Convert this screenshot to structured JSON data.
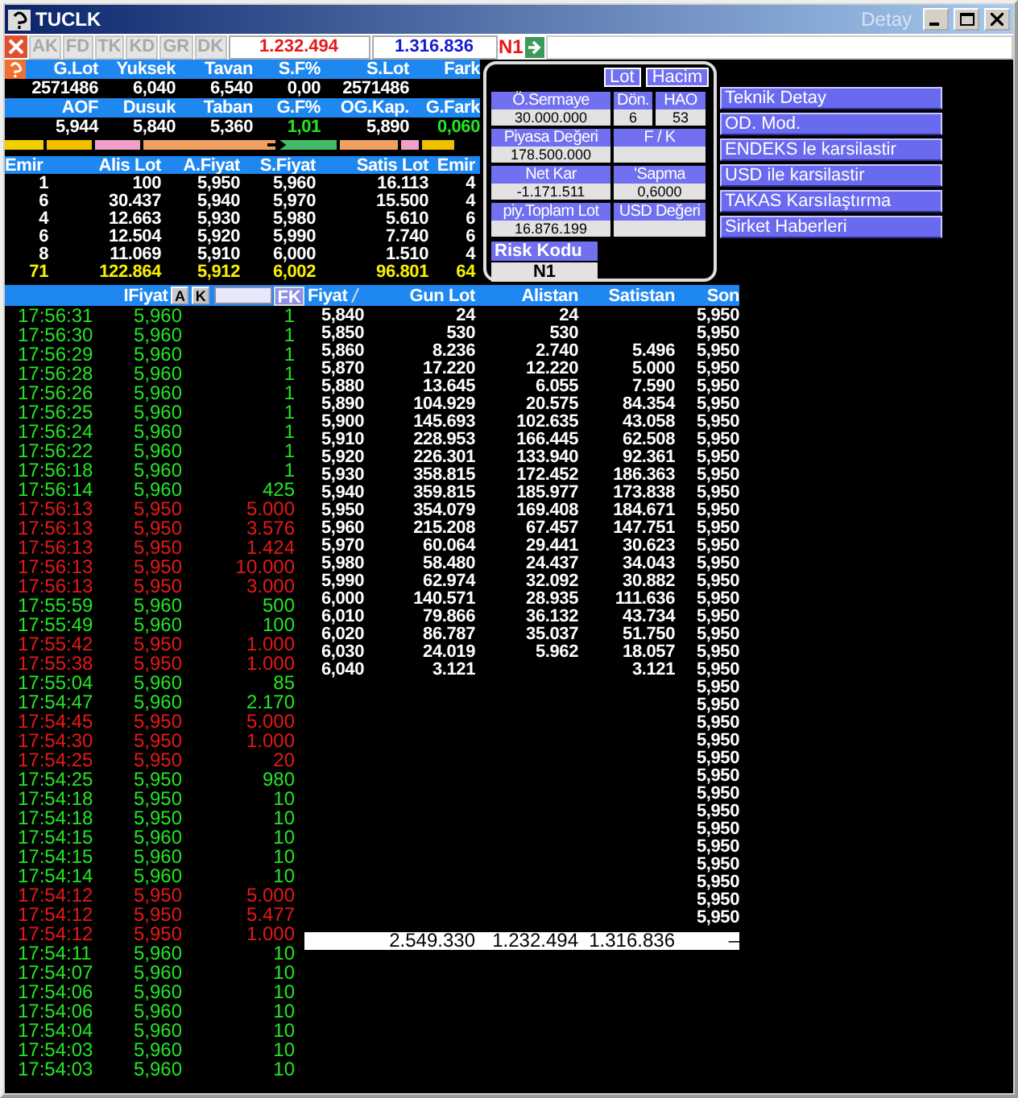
{
  "window": {
    "title": "TUCLK",
    "subtitle": "Detay"
  },
  "toolbar": {
    "buttons": [
      {
        "label": "AK",
        "disabled": true
      },
      {
        "label": "FD",
        "disabled": true
      },
      {
        "label": "TK",
        "disabled": true
      },
      {
        "label": "KD",
        "disabled": true
      },
      {
        "label": "GR",
        "disabled": true
      },
      {
        "label": "DK",
        "disabled": true
      }
    ],
    "bid_total": "1.232.494",
    "ask_total": "1.316.836",
    "risk": "N1"
  },
  "summary": {
    "rows": [
      {
        "headers": [
          "G.Lot",
          "Yuksek",
          "Tavan",
          "S.F%",
          "S.Lot",
          "Fark"
        ],
        "values": [
          {
            "text": "2571486",
            "positive": false
          },
          {
            "text": "6,040",
            "positive": false
          },
          {
            "text": "6,540",
            "positive": false
          },
          {
            "text": "0,00",
            "positive": false
          },
          {
            "text": "2571486",
            "positive": false
          }
        ]
      },
      {
        "headers": [
          "AOF",
          "Dusuk",
          "Taban",
          "G.F%",
          "OG.Kap.",
          "G.Fark"
        ],
        "values": [
          {
            "text": "5,944",
            "positive": false
          },
          {
            "text": "5,840",
            "positive": false
          },
          {
            "text": "5,360",
            "positive": false
          },
          {
            "text": "1,01",
            "positive": true
          },
          {
            "text": "5,890",
            "positive": false
          },
          {
            "text": "0,060",
            "positive": true
          }
        ]
      }
    ]
  },
  "depth": {
    "columns": [
      "Emir",
      "Alis Lot",
      "A.Fiyat",
      "S.Fiyat",
      "Satis Lot",
      "Emir"
    ],
    "rows": [
      [
        "1",
        "100",
        "5,950",
        "5,960",
        "16.113",
        "4"
      ],
      [
        "6",
        "30.437",
        "5,940",
        "5,970",
        "15.500",
        "4"
      ],
      [
        "4",
        "12.663",
        "5,930",
        "5,980",
        "5.610",
        "6"
      ],
      [
        "6",
        "12.504",
        "5,920",
        "5,990",
        "7.740",
        "6"
      ],
      [
        "8",
        "11.069",
        "5,910",
        "6,000",
        "1.510",
        "4"
      ]
    ],
    "total": [
      "71",
      "122.864",
      "5,912",
      "6,002",
      "96.801",
      "64"
    ]
  },
  "fundamentals": {
    "mode_buttons": [
      "Lot",
      "Hacim"
    ],
    "rows": [
      [
        {
          "label": "Ö.Sermaye",
          "value": "30.000.000"
        },
        {
          "label": "Dön.",
          "value": "6"
        },
        {
          "label": "HAO",
          "value": "53"
        }
      ],
      [
        {
          "label": "Piyasa Değeri",
          "value": "178.500.000"
        },
        {
          "label": "F / K"
        }
      ],
      [
        {
          "label": "Net Kar",
          "value": "-1.171.511"
        },
        {
          "label": "'Sapma",
          "value": "0,6000"
        }
      ],
      [
        {
          "label": "piy.Toplam Lot",
          "value": "16.876.199"
        },
        {
          "label": "USD Değeri"
        }
      ]
    ],
    "risk": {
      "label": "Risk Kodu",
      "value": "N1"
    }
  },
  "actions": [
    "Teknik Detay",
    "OD. Mod.",
    "ENDEKS le karsilastir",
    "USD ile karsilastir",
    "TAKAS Karsılaştırma",
    "Sirket Haberleri"
  ],
  "trades": {
    "price_label": "IFiyat",
    "buttons": [
      "A",
      "K"
    ],
    "filter_button": "FK",
    "rows": [
      {
        "time": "17:56:31",
        "price": "5,960",
        "lot": "1",
        "buy": true
      },
      {
        "time": "17:56:30",
        "price": "5,960",
        "lot": "1",
        "buy": true
      },
      {
        "time": "17:56:29",
        "price": "5,960",
        "lot": "1",
        "buy": true
      },
      {
        "time": "17:56:28",
        "price": "5,960",
        "lot": "1",
        "buy": true
      },
      {
        "time": "17:56:26",
        "price": "5,960",
        "lot": "1",
        "buy": true
      },
      {
        "time": "17:56:25",
        "price": "5,960",
        "lot": "1",
        "buy": true
      },
      {
        "time": "17:56:24",
        "price": "5,960",
        "lot": "1",
        "buy": true
      },
      {
        "time": "17:56:22",
        "price": "5,960",
        "lot": "1",
        "buy": true
      },
      {
        "time": "17:56:18",
        "price": "5,960",
        "lot": "1",
        "buy": true
      },
      {
        "time": "17:56:14",
        "price": "5,960",
        "lot": "425",
        "buy": true
      },
      {
        "time": "17:56:13",
        "price": "5,950",
        "lot": "5.000",
        "buy": false
      },
      {
        "time": "17:56:13",
        "price": "5,950",
        "lot": "3.576",
        "buy": false
      },
      {
        "time": "17:56:13",
        "price": "5,950",
        "lot": "1.424",
        "buy": false
      },
      {
        "time": "17:56:13",
        "price": "5,950",
        "lot": "10.000",
        "buy": false
      },
      {
        "time": "17:56:13",
        "price": "5,950",
        "lot": "3.000",
        "buy": false
      },
      {
        "time": "17:55:59",
        "price": "5,960",
        "lot": "500",
        "buy": true
      },
      {
        "time": "17:55:49",
        "price": "5,960",
        "lot": "100",
        "buy": true
      },
      {
        "time": "17:55:42",
        "price": "5,950",
        "lot": "1.000",
        "buy": false
      },
      {
        "time": "17:55:38",
        "price": "5,950",
        "lot": "1.000",
        "buy": false
      },
      {
        "time": "17:55:04",
        "price": "5,960",
        "lot": "85",
        "buy": true
      },
      {
        "time": "17:54:47",
        "price": "5,960",
        "lot": "2.170",
        "buy": true
      },
      {
        "time": "17:54:45",
        "price": "5,950",
        "lot": "5.000",
        "buy": false
      },
      {
        "time": "17:54:30",
        "price": "5,950",
        "lot": "1.000",
        "buy": false
      },
      {
        "time": "17:54:25",
        "price": "5,950",
        "lot": "20",
        "buy": false
      },
      {
        "time": "17:54:25",
        "price": "5,950",
        "lot": "980",
        "buy": true
      },
      {
        "time": "17:54:18",
        "price": "5,950",
        "lot": "10",
        "buy": true
      },
      {
        "time": "17:54:18",
        "price": "5,950",
        "lot": "10",
        "buy": true
      },
      {
        "time": "17:54:15",
        "price": "5,960",
        "lot": "10",
        "buy": true
      },
      {
        "time": "17:54:15",
        "price": "5,960",
        "lot": "10",
        "buy": true
      },
      {
        "time": "17:54:14",
        "price": "5,960",
        "lot": "10",
        "buy": true
      },
      {
        "time": "17:54:12",
        "price": "5,950",
        "lot": "5.000",
        "buy": false
      },
      {
        "time": "17:54:12",
        "price": "5,950",
        "lot": "5.477",
        "buy": false
      },
      {
        "time": "17:54:12",
        "price": "5,950",
        "lot": "1.000",
        "buy": false
      },
      {
        "time": "17:54:11",
        "price": "5,960",
        "lot": "10",
        "buy": true
      },
      {
        "time": "17:54:07",
        "price": "5,960",
        "lot": "10",
        "buy": true
      },
      {
        "time": "17:54:06",
        "price": "5,960",
        "lot": "10",
        "buy": true
      },
      {
        "time": "17:54:06",
        "price": "5,960",
        "lot": "10",
        "buy": true
      },
      {
        "time": "17:54:04",
        "price": "5,960",
        "lot": "10",
        "buy": true
      },
      {
        "time": "17:54:03",
        "price": "5,960",
        "lot": "10",
        "buy": true
      },
      {
        "time": "17:54:03",
        "price": "5,960",
        "lot": "10",
        "buy": true
      }
    ]
  },
  "price_table": {
    "columns": [
      "Fiyat",
      "Gun Lot",
      "Alistan",
      "Satistan",
      "Son"
    ],
    "rows": [
      {
        "price": "5,840",
        "gun_lot": "24",
        "alistan": "24",
        "son": "5,950"
      },
      {
        "price": "5,850",
        "gun_lot": "530",
        "alistan": "530",
        "son": "5,950"
      },
      {
        "price": "5,860",
        "gun_lot": "8.236",
        "alistan": "2.740",
        "satistan": "5.496",
        "son": "5,950"
      },
      {
        "price": "5,870",
        "gun_lot": "17.220",
        "alistan": "12.220",
        "satistan": "5.000",
        "son": "5,950"
      },
      {
        "price": "5,880",
        "gun_lot": "13.645",
        "alistan": "6.055",
        "satistan": "7.590",
        "son": "5,950"
      },
      {
        "price": "5,890",
        "gun_lot": "104.929",
        "alistan": "20.575",
        "satistan": "84.354",
        "son": "5,950"
      },
      {
        "price": "5,900",
        "gun_lot": "145.693",
        "alistan": "102.635",
        "satistan": "43.058",
        "son": "5,950"
      },
      {
        "price": "5,910",
        "gun_lot": "228.953",
        "alistan": "166.445",
        "satistan": "62.508",
        "son": "5,950"
      },
      {
        "price": "5,920",
        "gun_lot": "226.301",
        "alistan": "133.940",
        "satistan": "92.361",
        "son": "5,950"
      },
      {
        "price": "5,930",
        "gun_lot": "358.815",
        "alistan": "172.452",
        "satistan": "186.363",
        "son": "5,950"
      },
      {
        "price": "5,940",
        "gun_lot": "359.815",
        "alistan": "185.977",
        "satistan": "173.838",
        "son": "5,950"
      },
      {
        "price": "5,950",
        "gun_lot": "354.079",
        "alistan": "169.408",
        "satistan": "184.671",
        "son": "5,950"
      },
      {
        "price": "5,960",
        "gun_lot": "215.208",
        "alistan": "67.457",
        "satistan": "147.751",
        "son": "5,950"
      },
      {
        "price": "5,970",
        "gun_lot": "60.064",
        "alistan": "29.441",
        "satistan": "30.623",
        "son": "5,950"
      },
      {
        "price": "5,980",
        "gun_lot": "58.480",
        "alistan": "24.437",
        "satistan": "34.043",
        "son": "5,950"
      },
      {
        "price": "5,990",
        "gun_lot": "62.974",
        "alistan": "32.092",
        "satistan": "30.882",
        "son": "5,950"
      },
      {
        "price": "6,000",
        "gun_lot": "140.571",
        "alistan": "28.935",
        "satistan": "111.636",
        "son": "5,950"
      },
      {
        "price": "6,010",
        "gun_lot": "79.866",
        "alistan": "36.132",
        "satistan": "43.734",
        "son": "5,950"
      },
      {
        "price": "6,020",
        "gun_lot": "86.787",
        "alistan": "35.037",
        "satistan": "51.750",
        "son": "5,950"
      },
      {
        "price": "6,030",
        "gun_lot": "24.019",
        "alistan": "5.962",
        "satistan": "18.057",
        "son": "5,950"
      },
      {
        "price": "6,040",
        "gun_lot": "3.121",
        "satistan": "3.121",
        "son": "5,950"
      },
      {
        "son": "5,950"
      },
      {
        "son": "5,950"
      },
      {
        "son": "5,950"
      },
      {
        "son": "5,950"
      },
      {
        "son": "5,950"
      },
      {
        "son": "5,950"
      },
      {
        "son": "5,950"
      },
      {
        "son": "5,950"
      },
      {
        "son": "5,950"
      },
      {
        "son": "5,950"
      },
      {
        "son": "5,950"
      },
      {
        "son": "5,950"
      },
      {
        "son": "5,950"
      },
      {
        "son": "5,950"
      }
    ],
    "totals": [
      "2.549.330",
      "1.232.494",
      "1.316.836",
      "–"
    ]
  }
}
